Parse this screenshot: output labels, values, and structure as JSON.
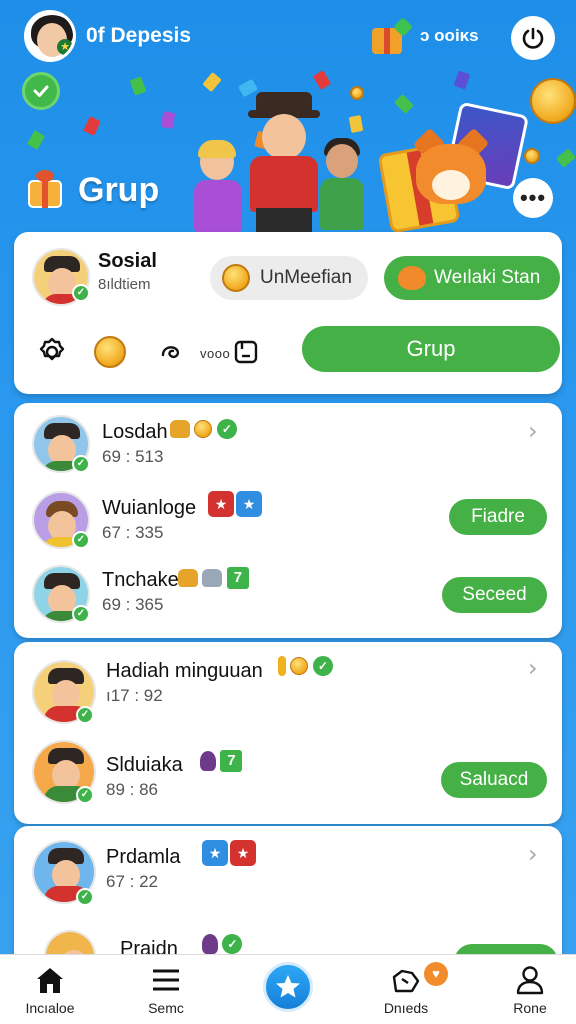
{
  "header": {
    "title": "0f Depesis",
    "coins_label": "ↄ ooiᴋs"
  },
  "banner": {
    "title": "Grup"
  },
  "profile": {
    "name": "Sosial",
    "subtitle": "8ıldtiem",
    "pill_gray_label": "UnMeefian",
    "pill_green_label": "Weılaki Stan",
    "tool_label": "vooo",
    "primary_button": "Grup"
  },
  "list1": [
    {
      "name": "Losdah",
      "sub": "69 : 513",
      "action": ""
    },
    {
      "name": "Wuianloge",
      "sub": "67 : 335",
      "action": "Fiadre"
    },
    {
      "name": "Tnchake",
      "sub": "69 : 365",
      "action": "Seceed"
    }
  ],
  "list2": [
    {
      "name": "Hadiah minguuan",
      "sub": "ı17 : 92",
      "action": ""
    },
    {
      "name": "Slduiaka",
      "sub": "89 : 86",
      "action": "Saluacd"
    }
  ],
  "list3": [
    {
      "name": "Prdamla",
      "sub": "67 : 22",
      "action": ""
    },
    {
      "name": "Praidn",
      "sub": "",
      "action": ""
    }
  ],
  "nav": {
    "items": [
      {
        "label": "Incıaloe"
      },
      {
        "label": "Semc"
      },
      {
        "label": "Dnıeds"
      },
      {
        "label": "Rone"
      }
    ],
    "badge_icon": "heart-icon"
  },
  "colors": {
    "accent_green": "#45b045",
    "background_blue": "#2a98ee",
    "nav_center": "#1e8ee8"
  }
}
